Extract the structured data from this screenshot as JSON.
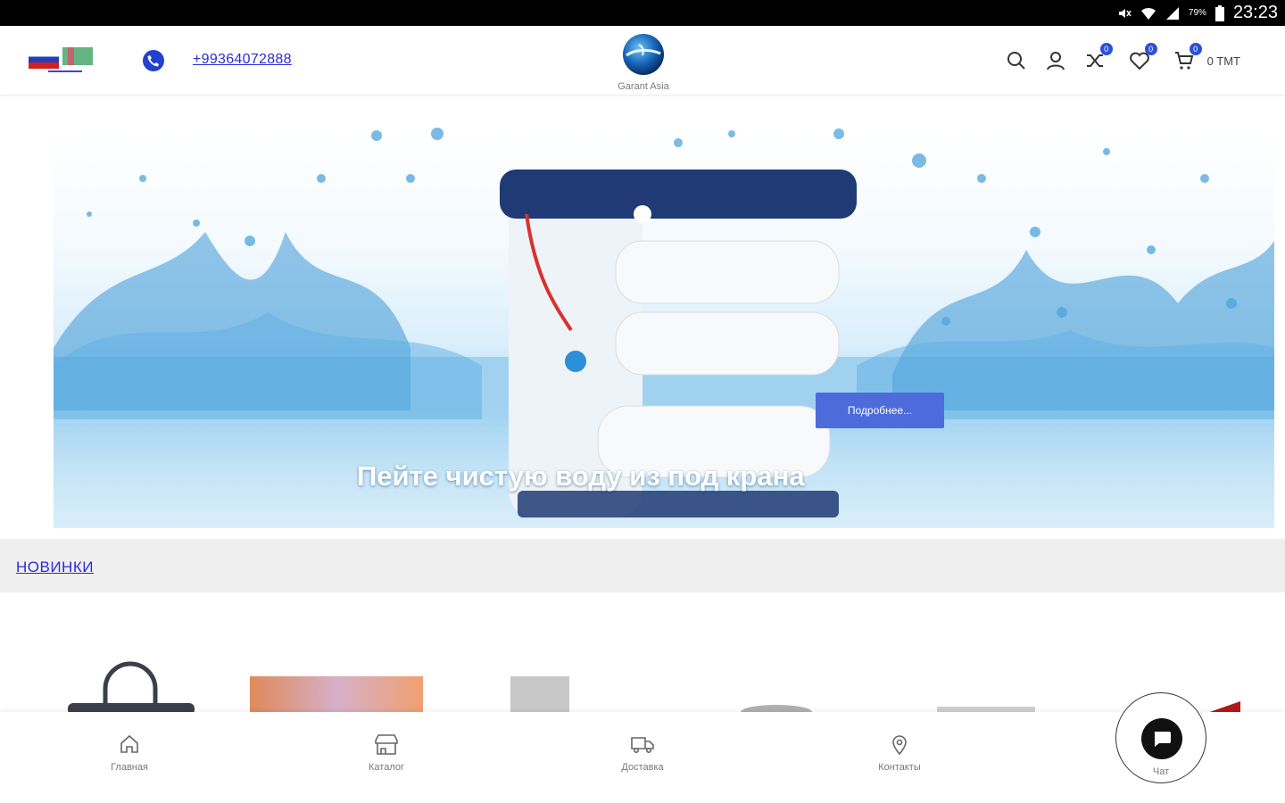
{
  "status_bar": {
    "battery": "79%",
    "time": "23:23"
  },
  "header": {
    "phone": "+99364072888",
    "logo_text": "Garant Asia",
    "compare_count": "0",
    "wishlist_count": "0",
    "cart_count": "0",
    "cart_total": "0 TMT"
  },
  "banner": {
    "button_label": "Подробнее...",
    "title": "Пейте чистую воду из под крана"
  },
  "section": {
    "title": "НОВИНКИ"
  },
  "bottom_nav": {
    "items": [
      {
        "label": "Главная",
        "icon": "home-icon"
      },
      {
        "label": "Каталог",
        "icon": "store-icon"
      },
      {
        "label": "Доставка",
        "icon": "truck-icon"
      },
      {
        "label": "Контакты",
        "icon": "location-pin-icon"
      }
    ],
    "chat_label": "Чат"
  },
  "colors": {
    "accent": "#2b50d8",
    "link": "#2b2bd6",
    "button": "#4e6bdc"
  }
}
